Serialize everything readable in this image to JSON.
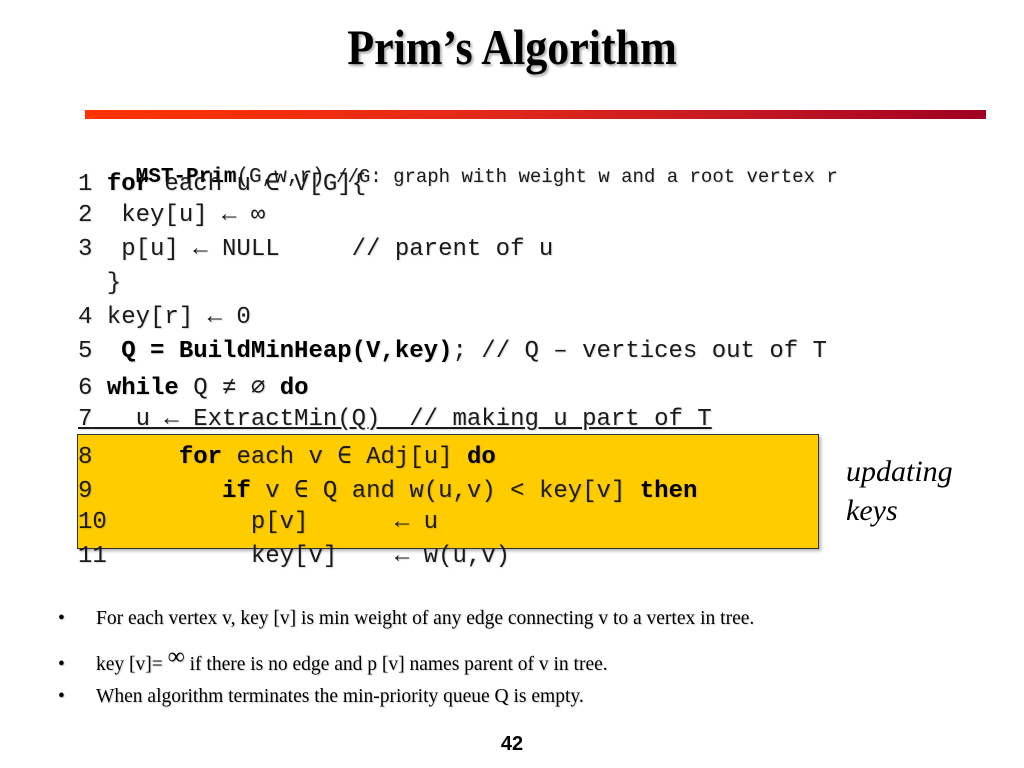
{
  "slide": {
    "title": "Prim’s Algorithm",
    "page_number": "42",
    "accent_colors": {
      "rule_start": "#ff3300",
      "rule_end": "#a00022",
      "highlight": "#ffcc00"
    }
  },
  "code": {
    "header": {
      "name": "MST-Prim",
      "args": "(G,w,r)",
      "comment": " //G: graph with weight w and a root vertex r"
    },
    "lines": [
      {
        "num": "1",
        "parts": [
          {
            "t": " "
          },
          {
            "t": "for",
            "kw": true
          },
          {
            "t": " each u ∈ V[G]{"
          }
        ]
      },
      {
        "num": "2",
        "parts": [
          {
            "t": "  key[u] ← ∞"
          }
        ]
      },
      {
        "num": "3",
        "parts": [
          {
            "t": "  p[u] ← NULL     // parent of u"
          }
        ]
      },
      {
        "num": "",
        "parts": [
          {
            "t": "  }"
          }
        ]
      },
      {
        "num": "4",
        "parts": [
          {
            "t": " key[r] ← 0"
          }
        ]
      },
      {
        "num": "5",
        "parts": [
          {
            "t": "  "
          },
          {
            "t": "Q = BuildMinHeap(V,key)",
            "kw": true
          },
          {
            "t": "; // Q – vertices out of T"
          }
        ]
      },
      {
        "num": "6",
        "parts": [
          {
            "t": " "
          },
          {
            "t": "while",
            "kw": true
          },
          {
            "t": " Q ≠ ∅ "
          },
          {
            "t": "do",
            "kw": true
          }
        ]
      },
      {
        "num": "7",
        "parts": [
          {
            "t": "   u ← ExtractMin(Q)  // making u part of T"
          }
        ]
      },
      {
        "num": "8",
        "parts": [
          {
            "t": "      "
          },
          {
            "t": "for",
            "kw": true
          },
          {
            "t": " each v ∈ Adj[u] "
          },
          {
            "t": "do",
            "kw": true
          }
        ]
      },
      {
        "num": "9",
        "parts": [
          {
            "t": "         "
          },
          {
            "t": "if",
            "kw": true
          },
          {
            "t": " v ∈ Q and w(u,v) < key[v] "
          },
          {
            "t": "then",
            "kw": true
          }
        ]
      },
      {
        "num": "10",
        "parts": [
          {
            "t": "          p[v]      ← u"
          }
        ]
      },
      {
        "num": "11",
        "parts": [
          {
            "t": "          key[v]    ← w(u,v)"
          }
        ]
      }
    ]
  },
  "side_note": {
    "line1": "updating",
    "line2": "keys"
  },
  "bullets": [
    {
      "marker": "•",
      "text": "For each vertex v, key [v] is min weight of any edge connecting v to a vertex in tree."
    },
    {
      "marker": "•",
      "text_before": "key [v]= ",
      "symbol": "∞",
      "text_after": " if there is no edge and p [v] names parent of v in tree."
    },
    {
      "marker": "•",
      "text": "When algorithm terminates the min-priority queue Q is empty."
    }
  ]
}
